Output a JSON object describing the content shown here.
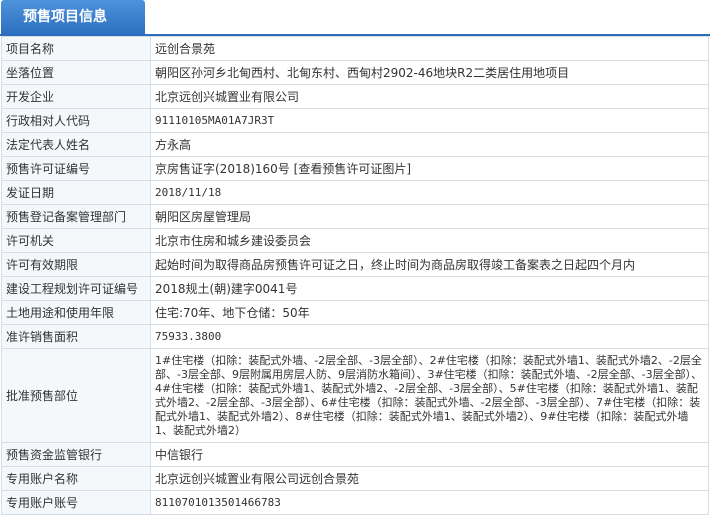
{
  "header": {
    "tab_label": "预售项目信息"
  },
  "rows": [
    {
      "label": "项目名称",
      "value": "远创合景苑"
    },
    {
      "label": "坐落位置",
      "value": "朝阳区孙河乡北甸西村、北甸东村、西甸村2902-46地块R2二类居住用地项目"
    },
    {
      "label": "开发企业",
      "value": "北京远创兴城置业有限公司"
    },
    {
      "label": "行政相对人代码",
      "value": "91110105MA01A7JR3T"
    },
    {
      "label": "法定代表人姓名",
      "value": "方永高"
    },
    {
      "label": "预售许可证编号",
      "value": "京房售证字(2018)160号",
      "link": "[查看预售许可证图片]"
    },
    {
      "label": "发证日期",
      "value": "2018/11/18"
    },
    {
      "label": "预售登记备案管理部门",
      "value": "朝阳区房屋管理局"
    },
    {
      "label": "许可机关",
      "value": "北京市住房和城乡建设委员会"
    },
    {
      "label": "许可有效期限",
      "value": "起始时间为取得商品房预售许可证之日，终止时间为商品房取得竣工备案表之日起四个月内"
    },
    {
      "label": "建设工程规划许可证编号",
      "value": "2018规土(朝)建字0041号"
    },
    {
      "label": "土地用途和使用年限",
      "value": "住宅:70年、地下仓储：50年"
    },
    {
      "label": "准许销售面积",
      "value": "75933.3800"
    },
    {
      "label": "批准预售部位",
      "value": "1#住宅楼（扣除：装配式外墙、-2层全部、-3层全部）、2#住宅楼（扣除：装配式外墙1、装配式外墙2、-2层全部、-3层全部、9层附属用房层人防、9层消防水箱间）、3#住宅楼（扣除：装配式外墙、-2层全部、-3层全部）、4#住宅楼（扣除：装配式外墙1、装配式外墙2、-2层全部、-3层全部）、5#住宅楼（扣除：装配式外墙1、装配式外墙2、-2层全部、-3层全部）、6#住宅楼（扣除：装配式外墙、-2层全部、-3层全部）、7#住宅楼（扣除：装配式外墙1、装配式外墙2）、8#住宅楼（扣除：装配式外墙1、装配式外墙2）、9#住宅楼（扣除：装配式外墙1、装配式外墙2）"
    },
    {
      "label": "预售资金监管银行",
      "value": "中信银行"
    },
    {
      "label": "专用账户名称",
      "value": "北京远创兴城置业有限公司远创合景苑"
    },
    {
      "label": "专用账户账号",
      "value": "8110701013501466783"
    }
  ]
}
